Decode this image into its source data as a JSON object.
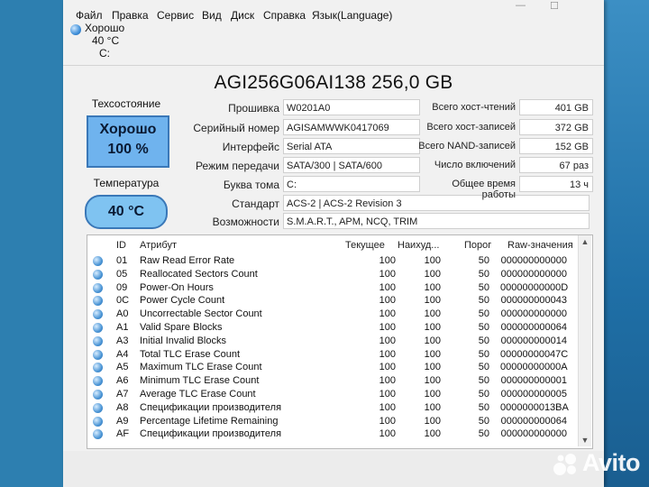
{
  "menu": [
    "Файл",
    "Правка",
    "Сервис",
    "Вид",
    "Диск",
    "Справка",
    "Язык(Language)"
  ],
  "window_controls": {
    "minimize": "—",
    "maximize": "☐"
  },
  "status_mini": {
    "state": "Хорошо",
    "temp": "40 °C",
    "drive": "C:"
  },
  "drive_title": "AGI256G06AI138 256,0 GB",
  "health": {
    "label": "Техсостояние",
    "status": "Хорошо",
    "percent": "100 %"
  },
  "temperature": {
    "label": "Температура",
    "value": "40 °C"
  },
  "fields": [
    {
      "label": "Прошивка",
      "value": "W0201A0"
    },
    {
      "label": "Серийный номер",
      "value": "AGISAMWWK0417069"
    },
    {
      "label": "Интерфейс",
      "value": "Serial ATA"
    },
    {
      "label": "Режим передачи",
      "value": "SATA/300 | SATA/600"
    },
    {
      "label": "Буква тома",
      "value": "C:"
    },
    {
      "label": "Стандарт",
      "value": "ACS-2 | ACS-2 Revision 3"
    },
    {
      "label": "Возможности",
      "value": "S.M.A.R.T., APM, NCQ, TRIM"
    }
  ],
  "right_fields": [
    {
      "label": "Всего хост-чтений",
      "value": "401 GB"
    },
    {
      "label": "Всего хост-записей",
      "value": "372 GB"
    },
    {
      "label": "Всего NAND-записей",
      "value": "152 GB"
    },
    {
      "label": "Число включений",
      "value": "67 раз"
    },
    {
      "label": "Общее время работы",
      "value": "13 ч"
    }
  ],
  "table": {
    "headers": [
      "ID",
      "Атрибут",
      "Текущее",
      "Наихуд...",
      "Порог",
      "Raw-значения"
    ],
    "rows": [
      {
        "id": "01",
        "name": "Raw Read Error Rate",
        "cur": "100",
        "worst": "100",
        "thr": "50",
        "raw": "000000000000"
      },
      {
        "id": "05",
        "name": "Reallocated Sectors Count",
        "cur": "100",
        "worst": "100",
        "thr": "50",
        "raw": "000000000000"
      },
      {
        "id": "09",
        "name": "Power-On Hours",
        "cur": "100",
        "worst": "100",
        "thr": "50",
        "raw": "00000000000D"
      },
      {
        "id": "0C",
        "name": "Power Cycle Count",
        "cur": "100",
        "worst": "100",
        "thr": "50",
        "raw": "000000000043"
      },
      {
        "id": "A0",
        "name": "Uncorrectable Sector Count",
        "cur": "100",
        "worst": "100",
        "thr": "50",
        "raw": "000000000000"
      },
      {
        "id": "A1",
        "name": "Valid Spare Blocks",
        "cur": "100",
        "worst": "100",
        "thr": "50",
        "raw": "000000000064"
      },
      {
        "id": "A3",
        "name": "Initial Invalid Blocks",
        "cur": "100",
        "worst": "100",
        "thr": "50",
        "raw": "000000000014"
      },
      {
        "id": "A4",
        "name": "Total TLC Erase Count",
        "cur": "100",
        "worst": "100",
        "thr": "50",
        "raw": "00000000047C"
      },
      {
        "id": "A5",
        "name": "Maximum TLC Erase Count",
        "cur": "100",
        "worst": "100",
        "thr": "50",
        "raw": "00000000000A"
      },
      {
        "id": "A6",
        "name": "Minimum TLC Erase Count",
        "cur": "100",
        "worst": "100",
        "thr": "50",
        "raw": "000000000001"
      },
      {
        "id": "A7",
        "name": "Average TLC Erase Count",
        "cur": "100",
        "worst": "100",
        "thr": "50",
        "raw": "000000000005"
      },
      {
        "id": "A8",
        "name": "Спецификации производителя",
        "cur": "100",
        "worst": "100",
        "thr": "50",
        "raw": "0000000013BA"
      },
      {
        "id": "A9",
        "name": "Percentage Lifetime Remaining",
        "cur": "100",
        "worst": "100",
        "thr": "50",
        "raw": "000000000064"
      },
      {
        "id": "AF",
        "name": "Спецификации производителя",
        "cur": "100",
        "worst": "100",
        "thr": "50",
        "raw": "000000000000"
      }
    ]
  },
  "watermark": "Avito",
  "colors": {
    "good_status": "#6fb3ee",
    "status_border": "#3a78b8",
    "desktop": "#2d7fb0"
  }
}
